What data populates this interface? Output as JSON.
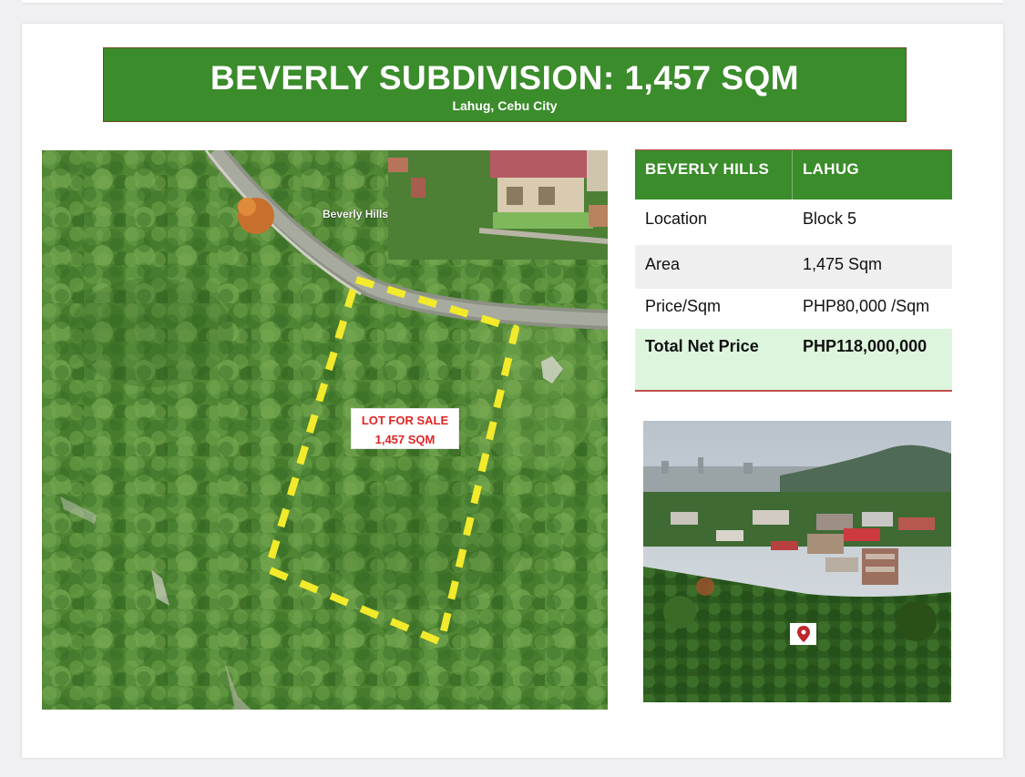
{
  "banner": {
    "title": "BEVERLY SUBDIVISION: 1,457 SQM",
    "subtitle": "Lahug, Cebu City"
  },
  "aerial_photo": {
    "place_label": "Beverly Hills",
    "sale_label_line1": "LOT FOR SALE",
    "sale_label_line2": "1,457 SQM",
    "boundary_color": "#f2ea2a"
  },
  "details_table": {
    "header": [
      "BEVERLY  HILLS",
      "LAHUG"
    ],
    "rows": [
      {
        "label": "Location",
        "value": "Block 5"
      },
      {
        "label": "Area",
        "value": "1,475 Sqm"
      },
      {
        "label": "Price/Sqm",
        "value": "PHP80,000 /Sqm"
      },
      {
        "label": "Total Net Price",
        "value": "PHP118,000,000"
      }
    ]
  },
  "city_photo": {
    "pin_icon": "map-pin-icon",
    "pin_color": "#c0272d"
  },
  "colors": {
    "banner_green": "#3b8c2b",
    "table_accent": "#c0504d",
    "total_row_bg": "#dcf5dc"
  }
}
